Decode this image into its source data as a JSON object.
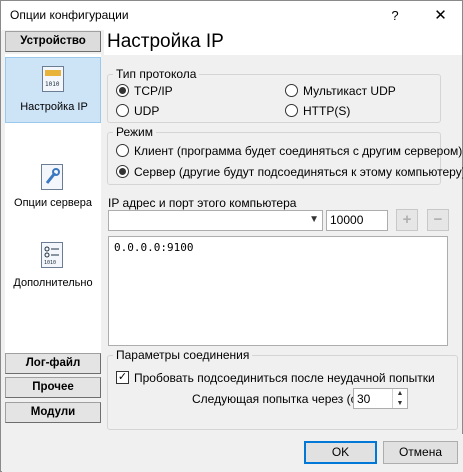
{
  "window": {
    "title": "Опции конфигурации",
    "help_glyph": "?",
    "close_glyph": "✕"
  },
  "sidebar": {
    "top_button": "Устройство",
    "items": [
      {
        "label": "Настройка IP",
        "icon": "network-card-icon",
        "selected": true
      },
      {
        "label": "Опции сервера",
        "icon": "wrench-settings-icon",
        "selected": false
      },
      {
        "label": "Дополнительно",
        "icon": "checklist-icon",
        "selected": false
      }
    ],
    "bottom_buttons": [
      "Лог-файл",
      "Прочее",
      "Модули"
    ]
  },
  "page": {
    "title": "Настройка IP"
  },
  "protocol": {
    "legend": "Тип протокола",
    "options": [
      {
        "label": "TCP/IP",
        "checked": true
      },
      {
        "label": "Мультикаст UDP",
        "checked": false
      },
      {
        "label": "UDP",
        "checked": false
      },
      {
        "label": "HTTP(S)",
        "checked": false
      }
    ]
  },
  "mode": {
    "legend": "Режим",
    "options": [
      {
        "label": "Клиент (программа будет соединяться с другим сервером)",
        "checked": false
      },
      {
        "label": "Сервер (другие будут подсоединяться к этому компьютеру)",
        "checked": true
      }
    ]
  },
  "address": {
    "label": "IP адрес и порт этого компьютера",
    "ip_value": "",
    "port_value": "10000",
    "add_glyph": "+",
    "remove_glyph": "−",
    "list": [
      "0.0.0.0:9100"
    ]
  },
  "connection": {
    "legend": "Параметры соединения",
    "retry_label": "Пробовать подсоединиться после неудачной попытки",
    "retry_checked": true,
    "check_glyph": "✓",
    "next_attempt_label": "Следующая попытка через (с)",
    "next_attempt_value": "30"
  },
  "footer": {
    "ok_label": "OK",
    "cancel_label": "Отмена"
  }
}
